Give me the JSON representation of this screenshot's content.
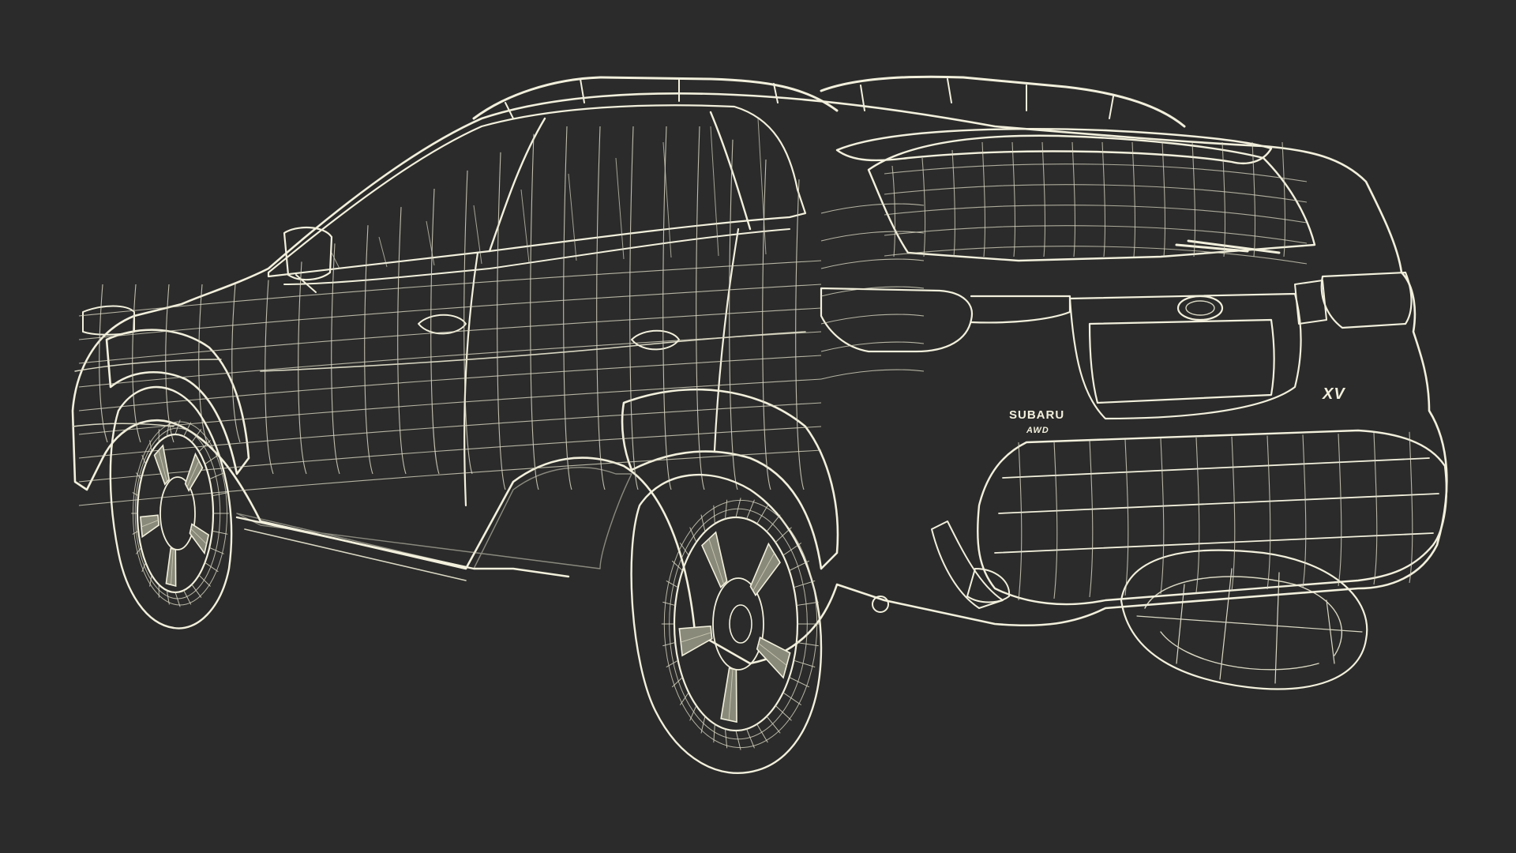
{
  "colors": {
    "background": "#2b2b2b",
    "body_fill": "#8a8a7a",
    "body_shadow": "#6e6e62",
    "glass_fill": "#7d7d70",
    "wire_main": "#f2f0dc",
    "wire_soft": "#d9d7c2",
    "tire_fill": "#85857a"
  },
  "car": {
    "brand_badge": "SUBARU",
    "model_badge": "XV",
    "drive_badge": "AWD"
  }
}
